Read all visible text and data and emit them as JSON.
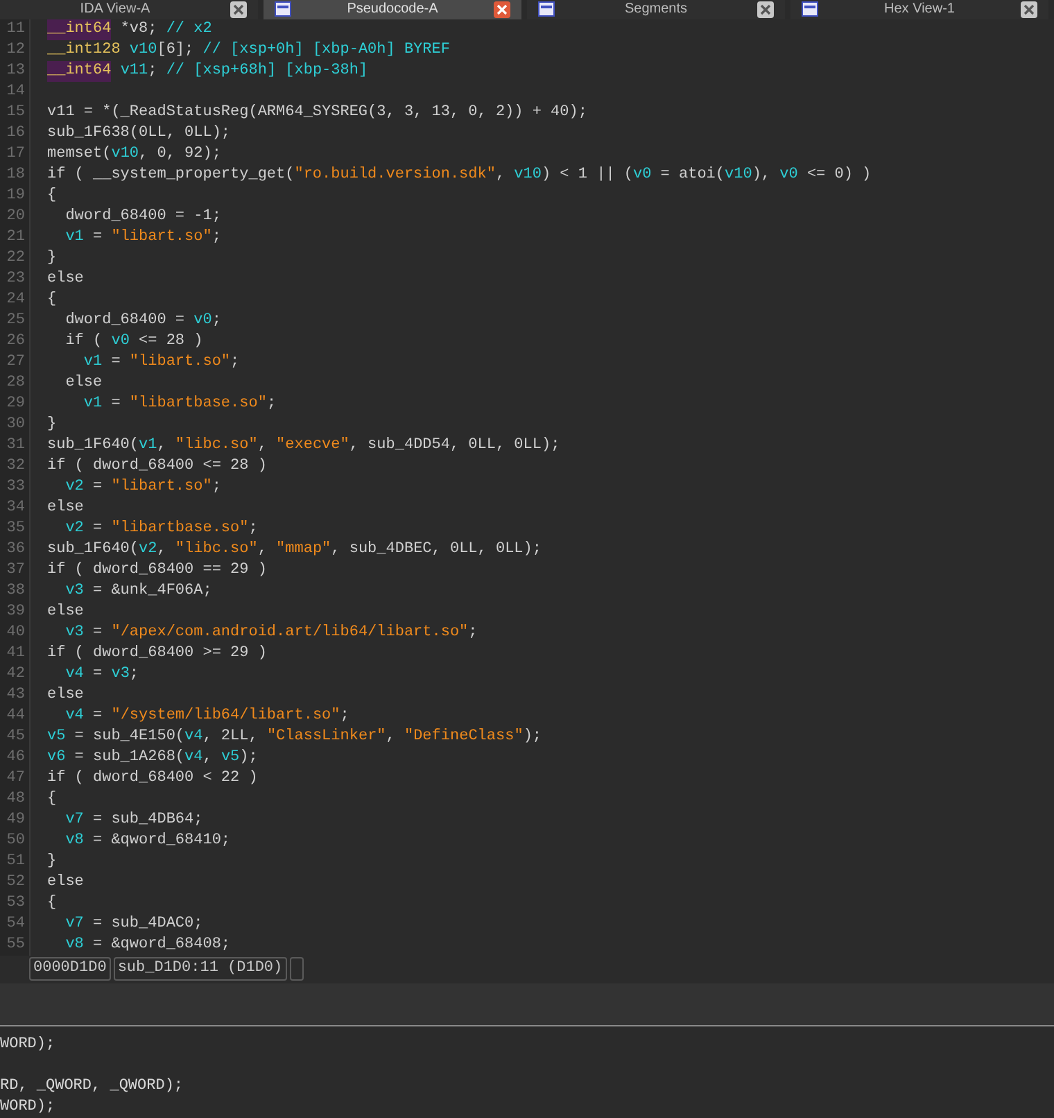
{
  "tabs": [
    {
      "label": "IDA View-A",
      "selected": false
    },
    {
      "label": "Pseudocode-A",
      "selected": true
    },
    {
      "label": "Segments",
      "selected": false
    },
    {
      "label": "Hex View-1",
      "selected": false
    }
  ],
  "code_lines": [
    {
      "n": "11",
      "tokens": [
        {
          "text": "__int64",
          "kind": "type_hl"
        },
        {
          "text": " *v8; ",
          "kind": "plain"
        },
        {
          "text": "// x2",
          "kind": "comment"
        }
      ]
    },
    {
      "n": "12",
      "tokens": [
        {
          "text": "__int128",
          "kind": "type"
        },
        {
          "text": " v10",
          "kind": "var"
        },
        {
          "text": "[6]; ",
          "kind": "plain"
        },
        {
          "text": "// [xsp+0h] [xbp-A0h] BYREF",
          "kind": "comment"
        }
      ]
    },
    {
      "n": "13",
      "tokens": [
        {
          "text": "__int64",
          "kind": "type_hl"
        },
        {
          "text": " v11",
          "kind": "var"
        },
        {
          "text": "; ",
          "kind": "plain"
        },
        {
          "text": "// [xsp+68h] [xbp-38h]",
          "kind": "comment"
        }
      ]
    },
    {
      "n": "14"
    },
    {
      "n": "15",
      "tokens": [
        {
          "text": "v11 = *(_ReadStatusReg(ARM64_SYSREG(3, 3, 13, 0, 2)) + 40);",
          "kind": "plain"
        }
      ]
    },
    {
      "n": "16",
      "tokens": [
        {
          "text": "sub_1F638(0LL, 0LL);",
          "kind": "plain"
        }
      ]
    },
    {
      "n": "17",
      "tokens": [
        {
          "text": "memset(",
          "kind": "plain"
        },
        {
          "text": "v10",
          "kind": "var"
        },
        {
          "text": ", 0, 92);",
          "kind": "plain"
        }
      ]
    },
    {
      "n": "18",
      "tokens": [
        {
          "text": "if ( __system_property_get(",
          "kind": "plain"
        },
        {
          "text": "\"ro.build.version.sdk\"",
          "kind": "string"
        },
        {
          "text": ", ",
          "kind": "plain"
        },
        {
          "text": "v10",
          "kind": "var"
        },
        {
          "text": ") < 1 || (",
          "kind": "plain"
        },
        {
          "text": "v0",
          "kind": "var"
        },
        {
          "text": " = atoi(",
          "kind": "plain"
        },
        {
          "text": "v10",
          "kind": "var"
        },
        {
          "text": "), ",
          "kind": "plain"
        },
        {
          "text": "v0",
          "kind": "var"
        },
        {
          "text": " <= 0) )",
          "kind": "plain"
        }
      ]
    },
    {
      "n": "19",
      "tokens": [
        {
          "text": "{",
          "kind": "plain"
        }
      ]
    },
    {
      "n": "20",
      "tokens": [
        {
          "text": "  dword_68400 = -1;",
          "kind": "plain"
        }
      ]
    },
    {
      "n": "21",
      "tokens": [
        {
          "text": "  v1",
          "kind": "var"
        },
        {
          "text": " = ",
          "kind": "plain"
        },
        {
          "text": "\"libart.so\"",
          "kind": "string"
        },
        {
          "text": ";",
          "kind": "plain"
        }
      ]
    },
    {
      "n": "22",
      "tokens": [
        {
          "text": "}",
          "kind": "plain"
        }
      ]
    },
    {
      "n": "23",
      "tokens": [
        {
          "text": "else",
          "kind": "plain"
        }
      ]
    },
    {
      "n": "24",
      "tokens": [
        {
          "text": "{",
          "kind": "plain"
        }
      ]
    },
    {
      "n": "25",
      "tokens": [
        {
          "text": "  dword_68400 = ",
          "kind": "plain"
        },
        {
          "text": "v0",
          "kind": "var"
        },
        {
          "text": ";",
          "kind": "plain"
        }
      ]
    },
    {
      "n": "26",
      "tokens": [
        {
          "text": "  if ( ",
          "kind": "plain"
        },
        {
          "text": "v0",
          "kind": "var"
        },
        {
          "text": " <= 28 )",
          "kind": "plain"
        }
      ]
    },
    {
      "n": "27",
      "tokens": [
        {
          "text": "    v1",
          "kind": "var"
        },
        {
          "text": " = ",
          "kind": "plain"
        },
        {
          "text": "\"libart.so\"",
          "kind": "string"
        },
        {
          "text": ";",
          "kind": "plain"
        }
      ]
    },
    {
      "n": "28",
      "tokens": [
        {
          "text": "  else",
          "kind": "plain"
        }
      ]
    },
    {
      "n": "29",
      "tokens": [
        {
          "text": "    v1",
          "kind": "var"
        },
        {
          "text": " = ",
          "kind": "plain"
        },
        {
          "text": "\"libartbase.so\"",
          "kind": "string"
        },
        {
          "text": ";",
          "kind": "plain"
        }
      ]
    },
    {
      "n": "30",
      "tokens": [
        {
          "text": "}",
          "kind": "plain"
        }
      ]
    },
    {
      "n": "31",
      "tokens": [
        {
          "text": "sub_1F640(",
          "kind": "plain"
        },
        {
          "text": "v1",
          "kind": "var"
        },
        {
          "text": ", ",
          "kind": "plain"
        },
        {
          "text": "\"libc.so\"",
          "kind": "string"
        },
        {
          "text": ", ",
          "kind": "plain"
        },
        {
          "text": "\"execve\"",
          "kind": "string"
        },
        {
          "text": ", sub_4DD54, 0LL, 0LL);",
          "kind": "plain"
        }
      ]
    },
    {
      "n": "32",
      "tokens": [
        {
          "text": "if ( dword_68400 <= 28 )",
          "kind": "plain"
        }
      ]
    },
    {
      "n": "33",
      "tokens": [
        {
          "text": "  v2",
          "kind": "var"
        },
        {
          "text": " = ",
          "kind": "plain"
        },
        {
          "text": "\"libart.so\"",
          "kind": "string"
        },
        {
          "text": ";",
          "kind": "plain"
        }
      ]
    },
    {
      "n": "34",
      "tokens": [
        {
          "text": "else",
          "kind": "plain"
        }
      ]
    },
    {
      "n": "35",
      "tokens": [
        {
          "text": "  v2",
          "kind": "var"
        },
        {
          "text": " = ",
          "kind": "plain"
        },
        {
          "text": "\"libartbase.so\"",
          "kind": "string"
        },
        {
          "text": ";",
          "kind": "plain"
        }
      ]
    },
    {
      "n": "36",
      "tokens": [
        {
          "text": "sub_1F640(",
          "kind": "plain"
        },
        {
          "text": "v2",
          "kind": "var"
        },
        {
          "text": ", ",
          "kind": "plain"
        },
        {
          "text": "\"libc.so\"",
          "kind": "string"
        },
        {
          "text": ", ",
          "kind": "plain"
        },
        {
          "text": "\"mmap\"",
          "kind": "string"
        },
        {
          "text": ", sub_4DBEC, 0LL, 0LL);",
          "kind": "plain"
        }
      ]
    },
    {
      "n": "37",
      "tokens": [
        {
          "text": "if ( dword_68400 == 29 )",
          "kind": "plain"
        }
      ]
    },
    {
      "n": "38",
      "tokens": [
        {
          "text": "  v3",
          "kind": "var"
        },
        {
          "text": " = &unk_4F06A;",
          "kind": "plain"
        }
      ]
    },
    {
      "n": "39",
      "tokens": [
        {
          "text": "else",
          "kind": "plain"
        }
      ]
    },
    {
      "n": "40",
      "tokens": [
        {
          "text": "  v3",
          "kind": "var"
        },
        {
          "text": " = ",
          "kind": "plain"
        },
        {
          "text": "\"/apex/com.android.art/lib64/libart.so\"",
          "kind": "string"
        },
        {
          "text": ";",
          "kind": "plain"
        }
      ]
    },
    {
      "n": "41",
      "tokens": [
        {
          "text": "if ( dword_68400 >= 29 )",
          "kind": "plain"
        }
      ]
    },
    {
      "n": "42",
      "tokens": [
        {
          "text": "  v4",
          "kind": "var"
        },
        {
          "text": " = ",
          "kind": "plain"
        },
        {
          "text": "v3",
          "kind": "var"
        },
        {
          "text": ";",
          "kind": "plain"
        }
      ]
    },
    {
      "n": "43",
      "tokens": [
        {
          "text": "else",
          "kind": "plain"
        }
      ]
    },
    {
      "n": "44",
      "tokens": [
        {
          "text": "  v4",
          "kind": "var"
        },
        {
          "text": " = ",
          "kind": "plain"
        },
        {
          "text": "\"/system/lib64/libart.so\"",
          "kind": "string"
        },
        {
          "text": ";",
          "kind": "plain"
        }
      ]
    },
    {
      "n": "45",
      "tokens": [
        {
          "text": "v5",
          "kind": "var"
        },
        {
          "text": " = sub_4E150(",
          "kind": "plain"
        },
        {
          "text": "v4",
          "kind": "var"
        },
        {
          "text": ", 2LL, ",
          "kind": "plain"
        },
        {
          "text": "\"ClassLinker\"",
          "kind": "string"
        },
        {
          "text": ", ",
          "kind": "plain"
        },
        {
          "text": "\"DefineClass\"",
          "kind": "string"
        },
        {
          "text": ");",
          "kind": "plain"
        }
      ]
    },
    {
      "n": "46",
      "tokens": [
        {
          "text": "v6",
          "kind": "var"
        },
        {
          "text": " = sub_1A268(",
          "kind": "plain"
        },
        {
          "text": "v4",
          "kind": "var"
        },
        {
          "text": ", ",
          "kind": "plain"
        },
        {
          "text": "v5",
          "kind": "var"
        },
        {
          "text": ");",
          "kind": "plain"
        }
      ]
    },
    {
      "n": "47",
      "tokens": [
        {
          "text": "if ( dword_68400 < 22 )",
          "kind": "plain"
        }
      ]
    },
    {
      "n": "48",
      "tokens": [
        {
          "text": "{",
          "kind": "plain"
        }
      ]
    },
    {
      "n": "49",
      "tokens": [
        {
          "text": "  v7",
          "kind": "var"
        },
        {
          "text": " = sub_4DB64;",
          "kind": "plain"
        }
      ]
    },
    {
      "n": "50",
      "tokens": [
        {
          "text": "  v8",
          "kind": "var"
        },
        {
          "text": " = &qword_68410;",
          "kind": "plain"
        }
      ]
    },
    {
      "n": "51",
      "tokens": [
        {
          "text": "}",
          "kind": "plain"
        }
      ]
    },
    {
      "n": "52",
      "tokens": [
        {
          "text": "else",
          "kind": "plain"
        }
      ]
    },
    {
      "n": "53",
      "tokens": [
        {
          "text": "{",
          "kind": "plain"
        }
      ]
    },
    {
      "n": "54",
      "tokens": [
        {
          "text": "  v7",
          "kind": "var"
        },
        {
          "text": " = sub_4DAC0;",
          "kind": "plain"
        }
      ]
    },
    {
      "n": "55",
      "tokens": [
        {
          "text": "  v8",
          "kind": "var"
        },
        {
          "text": " = &qword_68408;",
          "kind": "plain"
        }
      ]
    }
  ],
  "status_bar": {
    "address": "0000D1D0",
    "location": "sub_D1D0:11 (D1D0)"
  },
  "lower_panel": {
    "lines": [
      "WORD);",
      "RD, _QWORD, _QWORD);",
      "WORD);"
    ]
  }
}
